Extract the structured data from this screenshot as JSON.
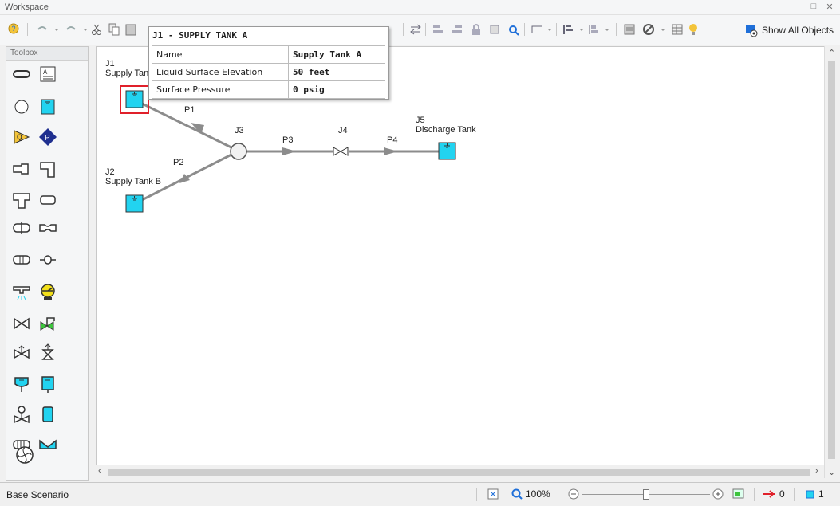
{
  "window": {
    "title": "Workspace",
    "restore_glyph": "□",
    "close_glyph": "✕"
  },
  "toolbar": {
    "show_all_label": "Show All Objects"
  },
  "toolbox": {
    "title": "Toolbox"
  },
  "tooltip": {
    "title": "J1 - SUPPLY TANK A",
    "rows": [
      {
        "label": "Name",
        "value": "Supply Tank A"
      },
      {
        "label": "Liquid Surface Elevation",
        "value": "50 feet"
      },
      {
        "label": "Surface Pressure",
        "value": "0 psig"
      }
    ]
  },
  "junctions": {
    "j1": {
      "id": "J1",
      "name": "Supply Tank A"
    },
    "j2": {
      "id": "J2",
      "name": "Supply Tank B"
    },
    "j3": {
      "id": "J3"
    },
    "j4": {
      "id": "J4"
    },
    "j5": {
      "id": "J5",
      "name": "Discharge Tank"
    }
  },
  "pipes": {
    "p1": "P1",
    "p2": "P2",
    "p3": "P3",
    "p4": "P4"
  },
  "statusbar": {
    "scenario": "Base Scenario",
    "zoom": "100%",
    "pipe_count": "0",
    "junction_count": "1"
  },
  "colors": {
    "tank_fill": "#22d3f0",
    "pipe": "#8c8c8c",
    "selection": "#e0202a",
    "accent_blue": "#1e6fd9"
  }
}
